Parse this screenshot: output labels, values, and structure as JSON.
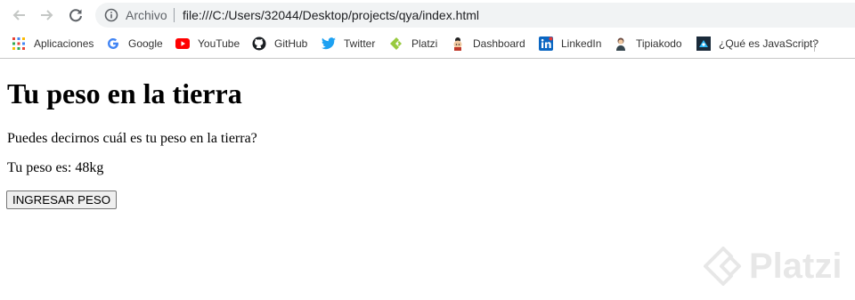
{
  "browser": {
    "omnibox": {
      "scheme_label": "Archivo",
      "url": "file:///C:/Users/32044/Desktop/projects/qya/index.html"
    },
    "bookmarks": [
      {
        "label": "Aplicaciones",
        "icon": "apps-grid-icon"
      },
      {
        "label": "Google",
        "icon": "google-icon"
      },
      {
        "label": "YouTube",
        "icon": "youtube-icon"
      },
      {
        "label": "GitHub",
        "icon": "github-icon"
      },
      {
        "label": "Twitter",
        "icon": "twitter-icon"
      },
      {
        "label": "Platzi",
        "icon": "platzi-icon"
      },
      {
        "label": "Dashboard",
        "icon": "dashboard-avatar-icon"
      },
      {
        "label": "LinkedIn",
        "icon": "linkedin-icon"
      },
      {
        "label": "Tipiakodo",
        "icon": "tipiakodo-icon"
      },
      {
        "label": "¿Qué es JavaScript?",
        "icon": "javascript-page-icon"
      }
    ]
  },
  "page": {
    "heading": "Tu peso en la tierra",
    "question": "Puedes decirnos cuál es tu peso en la tierra?",
    "result": "Tu peso es: 48kg",
    "button_label": "INGRESAR PESO"
  },
  "watermark": {
    "text": "Platzi"
  },
  "colors": {
    "google_blue": "#4285f4",
    "youtube_red": "#ff0000",
    "twitter_blue": "#1da1f2",
    "platzi_green": "#98ca3f",
    "linkedin_blue": "#0a66c2"
  }
}
